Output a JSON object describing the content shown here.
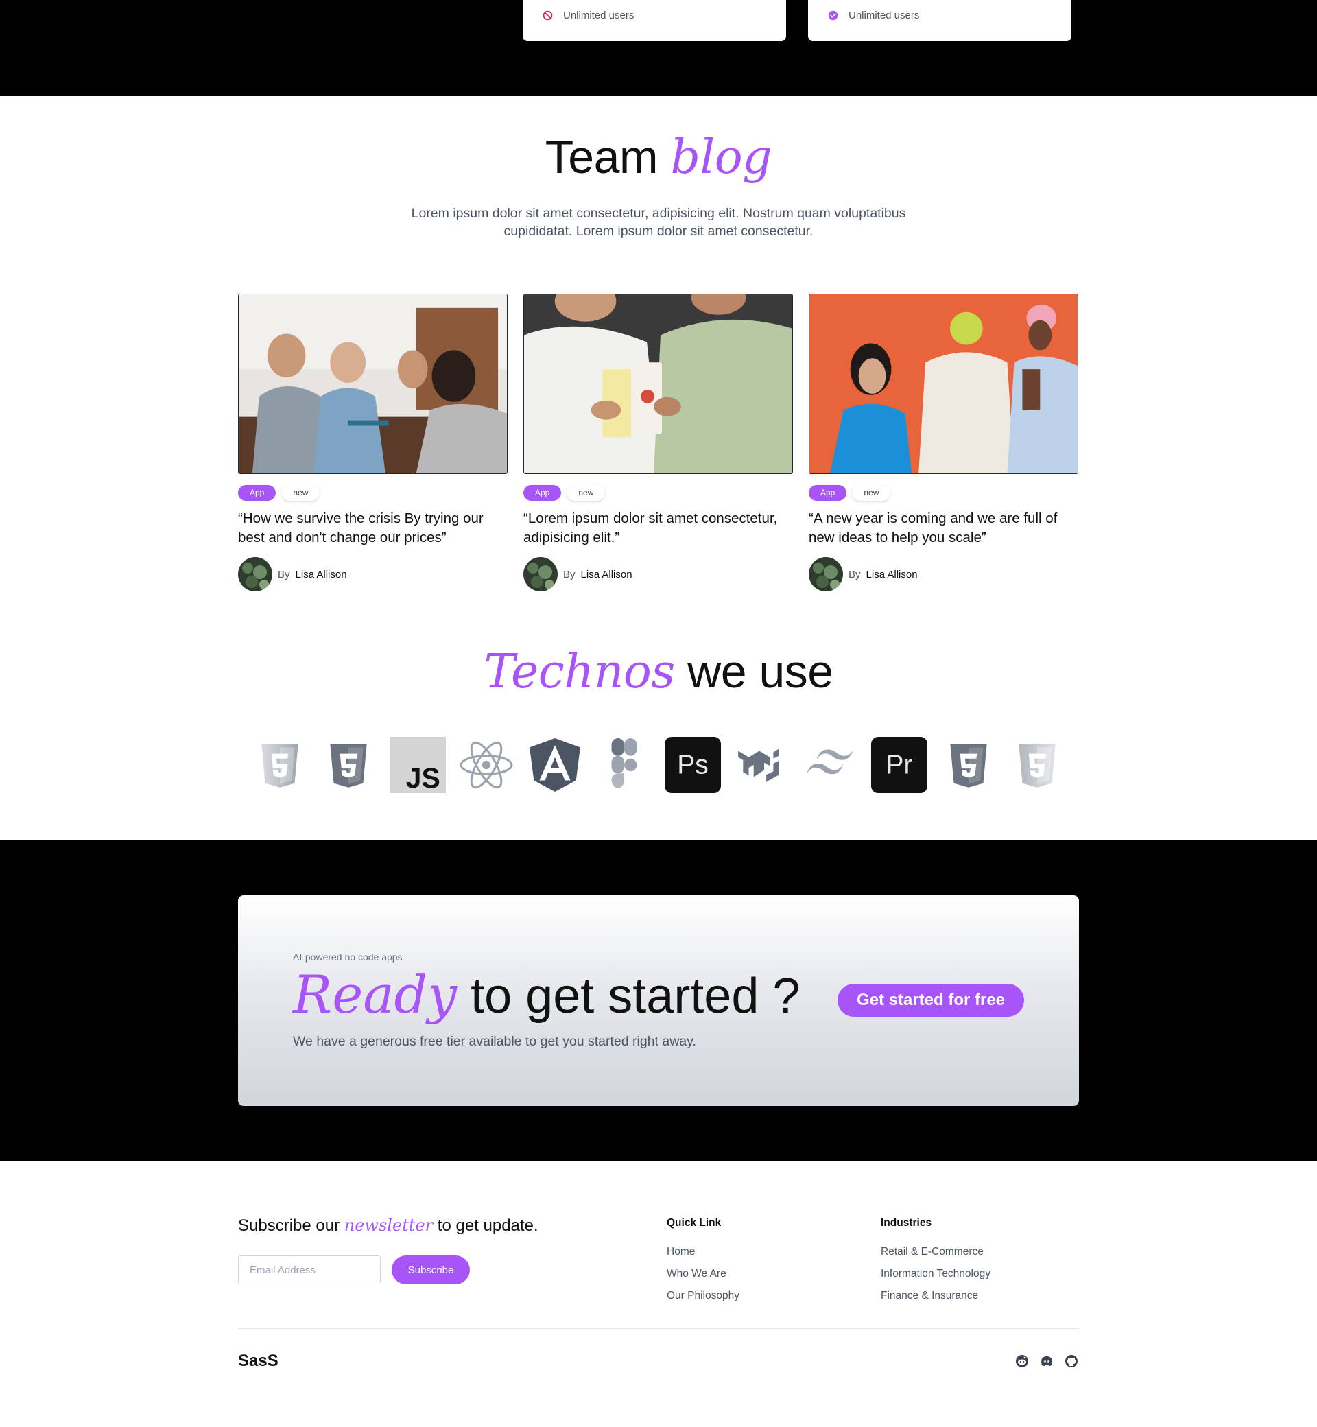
{
  "pricing": {
    "left_feature": "Unlimited users",
    "right_feature": "Unlimited users",
    "colors": {
      "excluded": "#e11d48",
      "included": "#a855f7"
    }
  },
  "blog": {
    "title_plain": "Team",
    "title_script": "blog",
    "subtitle": "Lorem ipsum dolor sit amet consectetur, adipisicing elit. Nostrum quam voluptatibus cupididatat. Lorem ipsum dolor sit amet consectetur.",
    "posts": [
      {
        "tags": [
          "App",
          "new"
        ],
        "title": "“How we survive the crisis By trying our best and don't change our prices”",
        "by": "By",
        "author": "Lisa Allison",
        "image": "team-meeting-photo"
      },
      {
        "tags": [
          "App",
          "new"
        ],
        "title": "“Lorem ipsum dolor sit amet consectetur, adipisicing elit.”",
        "by": "By",
        "author": "Lisa Allison",
        "image": "friends-juice-photo"
      },
      {
        "tags": [
          "App",
          "new"
        ],
        "title": "“A new year is coming and we are full of new ideas to help you scale”",
        "by": "By",
        "author": "Lisa Allison",
        "image": "fashion-group-photo"
      }
    ]
  },
  "technos": {
    "title_script": "Technos",
    "title_plain": "we use",
    "logos": [
      "html5-icon",
      "css3-icon",
      "javascript-icon",
      "react-icon",
      "angular-icon",
      "figma-icon",
      "photoshop-icon",
      "material-ui-icon",
      "tailwind-icon",
      "premiere-icon",
      "html5-icon",
      "css3-icon"
    ]
  },
  "cta": {
    "kicker": "AI-powered no code apps",
    "title_script": "Ready",
    "title_plain": "to get started ?",
    "subtitle": "We have a generous free tier available to get you started right away.",
    "button": "Get started for free"
  },
  "footer": {
    "subscribe_pre": "Subscribe our",
    "subscribe_script": "newsletter",
    "subscribe_post": "to get update.",
    "email_placeholder": "Email Address",
    "subscribe_button": "Subscribe",
    "quick_link": {
      "heading": "Quick Link",
      "links": [
        "Home",
        "Who We Are",
        "Our Philosophy"
      ]
    },
    "industries": {
      "heading": "Industries",
      "links": [
        "Retail & E-Commerce",
        "Information Technology",
        "Finance & Insurance"
      ]
    },
    "brand": "SasS",
    "socials": [
      "reddit-icon",
      "discord-icon",
      "github-icon"
    ]
  },
  "accent": "#a855f7"
}
